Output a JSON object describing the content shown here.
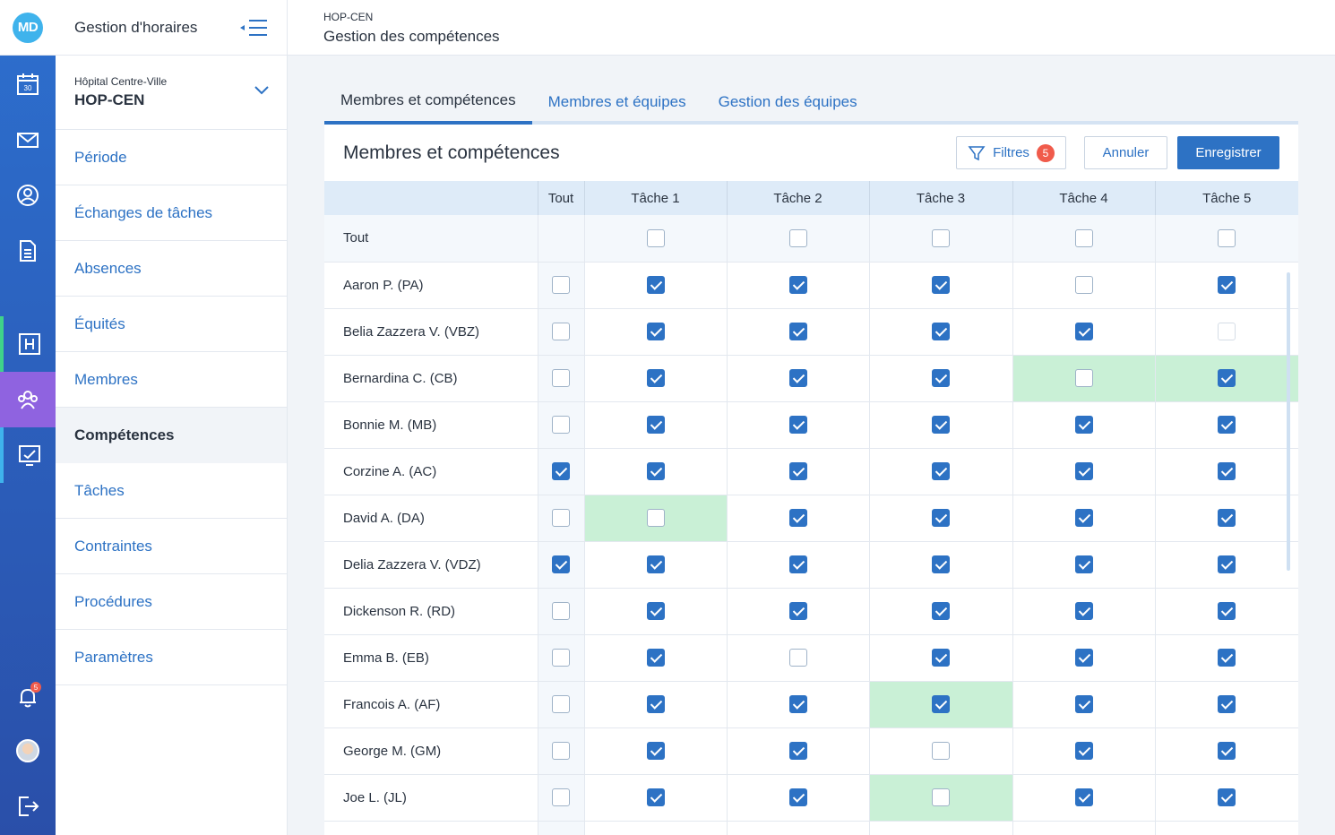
{
  "app": {
    "logo": "MD",
    "title": "Gestion d'horaires"
  },
  "rail": {
    "icons": [
      "calendar-icon",
      "mail-icon",
      "user-circle-icon",
      "document-icon",
      "hospital-icon",
      "team-icon",
      "presentation-icon"
    ],
    "calendar_day": "30",
    "notifications_count": "5"
  },
  "org": {
    "name": "Hôpital Centre-Ville",
    "code": "HOP-CEN"
  },
  "nav": [
    {
      "label": "Période",
      "active": false
    },
    {
      "label": "Échanges de tâches",
      "active": false
    },
    {
      "label": "Absences",
      "active": false
    },
    {
      "label": "Équités",
      "active": false
    },
    {
      "label": "Membres",
      "active": false
    },
    {
      "label": "Compétences",
      "active": true
    },
    {
      "label": "Tâches",
      "active": false
    },
    {
      "label": "Contraintes",
      "active": false
    },
    {
      "label": "Procédures",
      "active": false
    },
    {
      "label": "Paramètres",
      "active": false
    }
  ],
  "topbar": {
    "breadcrumb": "HOP-CEN",
    "title": "Gestion des compétences"
  },
  "tabs": [
    {
      "label": "Membres et compétences",
      "active": true
    },
    {
      "label": "Membres et équipes",
      "active": false
    },
    {
      "label": "Gestion des équipes",
      "active": false
    }
  ],
  "card": {
    "title": "Membres et compétences",
    "filter_label": "Filtres",
    "filter_count": "5",
    "cancel_label": "Annuler",
    "save_label": "Enregistrer"
  },
  "table": {
    "all_label": "Tout",
    "columns": [
      "Tout",
      "Tâche 1",
      "Tâche 2",
      "Tâche 3",
      "Tâche 4",
      "Tâche 5"
    ],
    "rows": [
      {
        "name": "Aaron P. (PA)",
        "all": false,
        "tasks": [
          true,
          true,
          true,
          false,
          true
        ],
        "highlight": []
      },
      {
        "name": "Belia Zazzera V. (VBZ)",
        "all": false,
        "tasks": [
          true,
          true,
          true,
          true,
          false
        ],
        "highlight": []
      },
      {
        "name": "Bernardina C. (CB)",
        "all": false,
        "tasks": [
          true,
          true,
          true,
          false,
          true
        ],
        "highlight": [
          3,
          4
        ]
      },
      {
        "name": "Bonnie M. (MB)",
        "all": false,
        "tasks": [
          true,
          true,
          true,
          true,
          true
        ],
        "highlight": []
      },
      {
        "name": "Corzine A. (AC)",
        "all": true,
        "tasks": [
          true,
          true,
          true,
          true,
          true
        ],
        "highlight": []
      },
      {
        "name": "David A. (DA)",
        "all": false,
        "tasks": [
          false,
          true,
          true,
          true,
          true
        ],
        "highlight": [
          0
        ]
      },
      {
        "name": "Delia Zazzera V. (VDZ)",
        "all": true,
        "tasks": [
          true,
          true,
          true,
          true,
          true
        ],
        "highlight": []
      },
      {
        "name": "Dickenson R. (RD)",
        "all": false,
        "tasks": [
          true,
          true,
          true,
          true,
          true
        ],
        "highlight": []
      },
      {
        "name": "Emma B. (EB)",
        "all": false,
        "tasks": [
          true,
          false,
          true,
          true,
          true
        ],
        "highlight": []
      },
      {
        "name": "Francois A. (AF)",
        "all": false,
        "tasks": [
          true,
          true,
          true,
          true,
          true
        ],
        "highlight": [
          2
        ]
      },
      {
        "name": "George M. (GM)",
        "all": false,
        "tasks": [
          true,
          true,
          false,
          true,
          true
        ],
        "highlight": []
      },
      {
        "name": "Joe L. (JL)",
        "all": false,
        "tasks": [
          true,
          true,
          false,
          true,
          true
        ],
        "highlight": [
          2
        ]
      },
      {
        "name": "",
        "all": false,
        "tasks": [
          false,
          false,
          false,
          false,
          false
        ],
        "highlight": []
      }
    ]
  },
  "colors": {
    "primary": "#2d72c4",
    "highlight": "#c9f0d6",
    "active_rail": "#8f63e0",
    "badge": "#f05b4b"
  }
}
